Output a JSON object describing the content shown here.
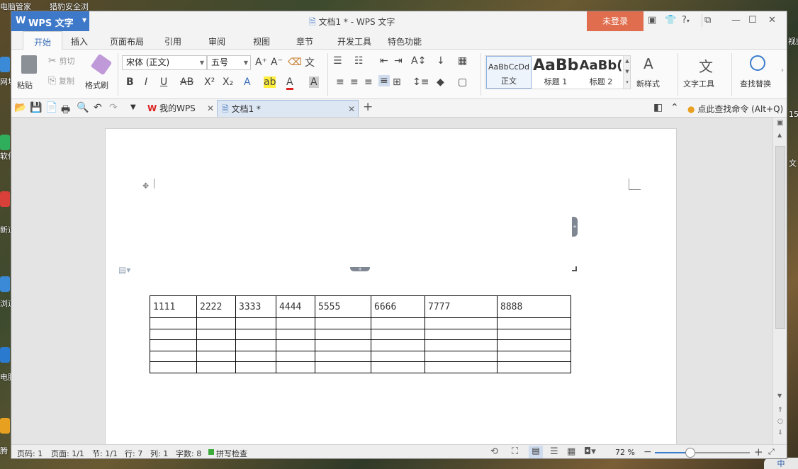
{
  "desktop": {
    "top_labels": [
      "电脑管家",
      "猎豹安全浏"
    ],
    "left_labels": [
      "网址",
      "软件",
      "新道",
      "浏道",
      "电脑霸",
      "腾"
    ],
    "right_labels": [
      "视频",
      "15",
      "文"
    ],
    "ime": "中"
  },
  "window": {
    "title": "文档1 * - WPS 文字",
    "app_button": "WPS 文字",
    "login": "未登录"
  },
  "menu": {
    "tabs": [
      "开始",
      "插入",
      "页面布局",
      "引用",
      "审阅",
      "视图",
      "章节",
      "开发工具",
      "特色功能"
    ]
  },
  "ribbon": {
    "paste": "粘贴",
    "cut": "剪切",
    "copy": "复制",
    "format_painter": "格式刷",
    "font_name": "宋体 (正文)",
    "font_size": "五号",
    "styles": [
      {
        "preview": "AaBbCcDd",
        "name": "正文"
      },
      {
        "preview": "AaBb",
        "name": "标题 1"
      },
      {
        "preview": "AaBb(",
        "name": "标题 2"
      }
    ],
    "new_style": "新样式",
    "text_tools": "文字工具",
    "find_replace": "查找替换"
  },
  "quickbar": {
    "tabs": [
      {
        "label": "我的WPS"
      },
      {
        "label": "文档1 *"
      }
    ],
    "search_hint": "点此查找命令 (Alt+Q)"
  },
  "document": {
    "table": {
      "header": [
        "1111",
        "2222",
        "3333",
        "4444",
        "5555",
        "6666",
        "7777",
        "8888"
      ],
      "empty_rows": 5
    }
  },
  "status": {
    "page": "页码: 1",
    "pages": "页面: 1/1",
    "section": "节: 1/1",
    "row": "行: 7",
    "col": "列: 1",
    "words": "字数: 8",
    "spell": "拼写检查",
    "zoom": "72 %",
    "zoom_fraction": 0.37
  }
}
